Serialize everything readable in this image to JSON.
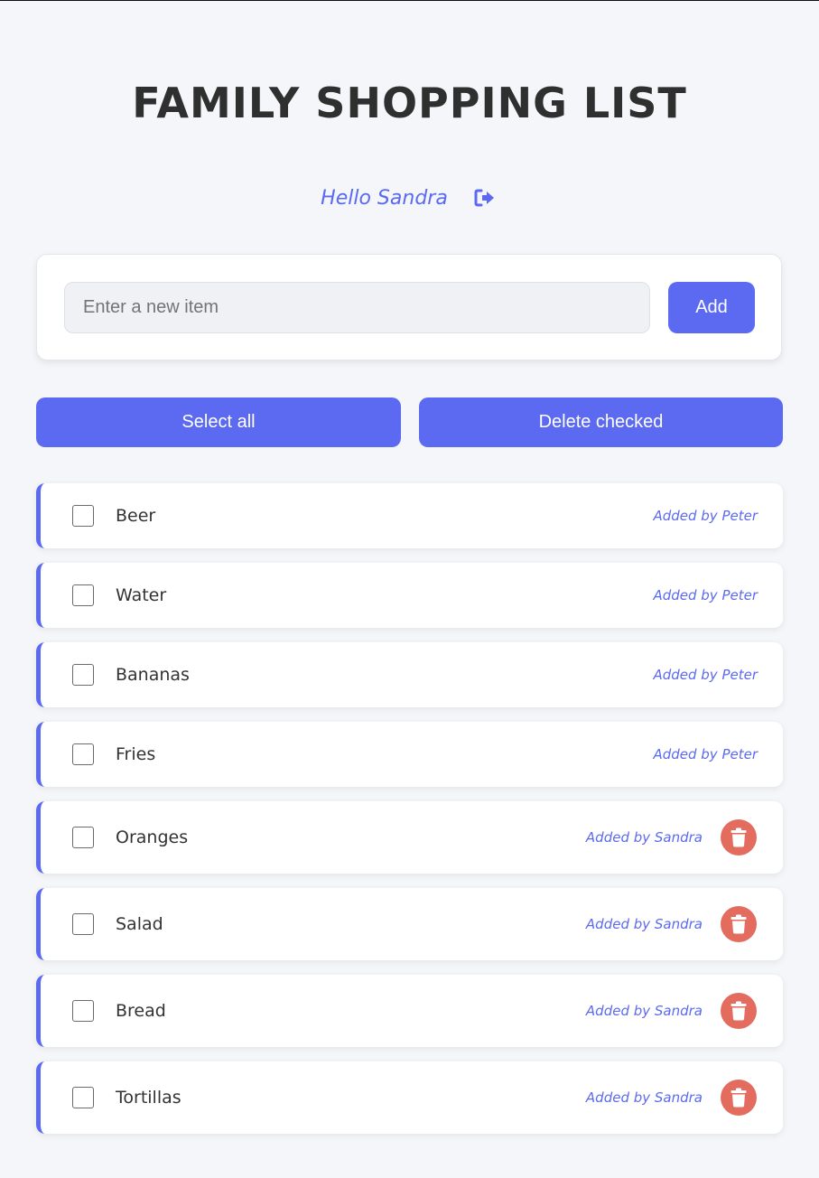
{
  "header": {
    "title": "FAMILY SHOPPING LIST",
    "greeting": "Hello Sandra",
    "logout_icon": "sign-out-icon"
  },
  "add_form": {
    "placeholder": "Enter a new item",
    "value": "",
    "add_label": "Add"
  },
  "actions": {
    "select_all_label": "Select all",
    "delete_checked_label": "Delete checked"
  },
  "colors": {
    "accent": "#5b6af0",
    "delete": "#e36c5f",
    "background": "#f4f6f9"
  },
  "items": [
    {
      "name": "Beer",
      "added_by": "Added by Peter",
      "checked": false,
      "deletable": false
    },
    {
      "name": "Water",
      "added_by": "Added by Peter",
      "checked": false,
      "deletable": false
    },
    {
      "name": "Bananas",
      "added_by": "Added by Peter",
      "checked": false,
      "deletable": false
    },
    {
      "name": "Fries",
      "added_by": "Added by Peter",
      "checked": false,
      "deletable": false
    },
    {
      "name": "Oranges",
      "added_by": "Added by Sandra",
      "checked": false,
      "deletable": true
    },
    {
      "name": "Salad",
      "added_by": "Added by Sandra",
      "checked": false,
      "deletable": true
    },
    {
      "name": "Bread",
      "added_by": "Added by Sandra",
      "checked": false,
      "deletable": true
    },
    {
      "name": "Tortillas",
      "added_by": "Added by Sandra",
      "checked": false,
      "deletable": true
    }
  ]
}
